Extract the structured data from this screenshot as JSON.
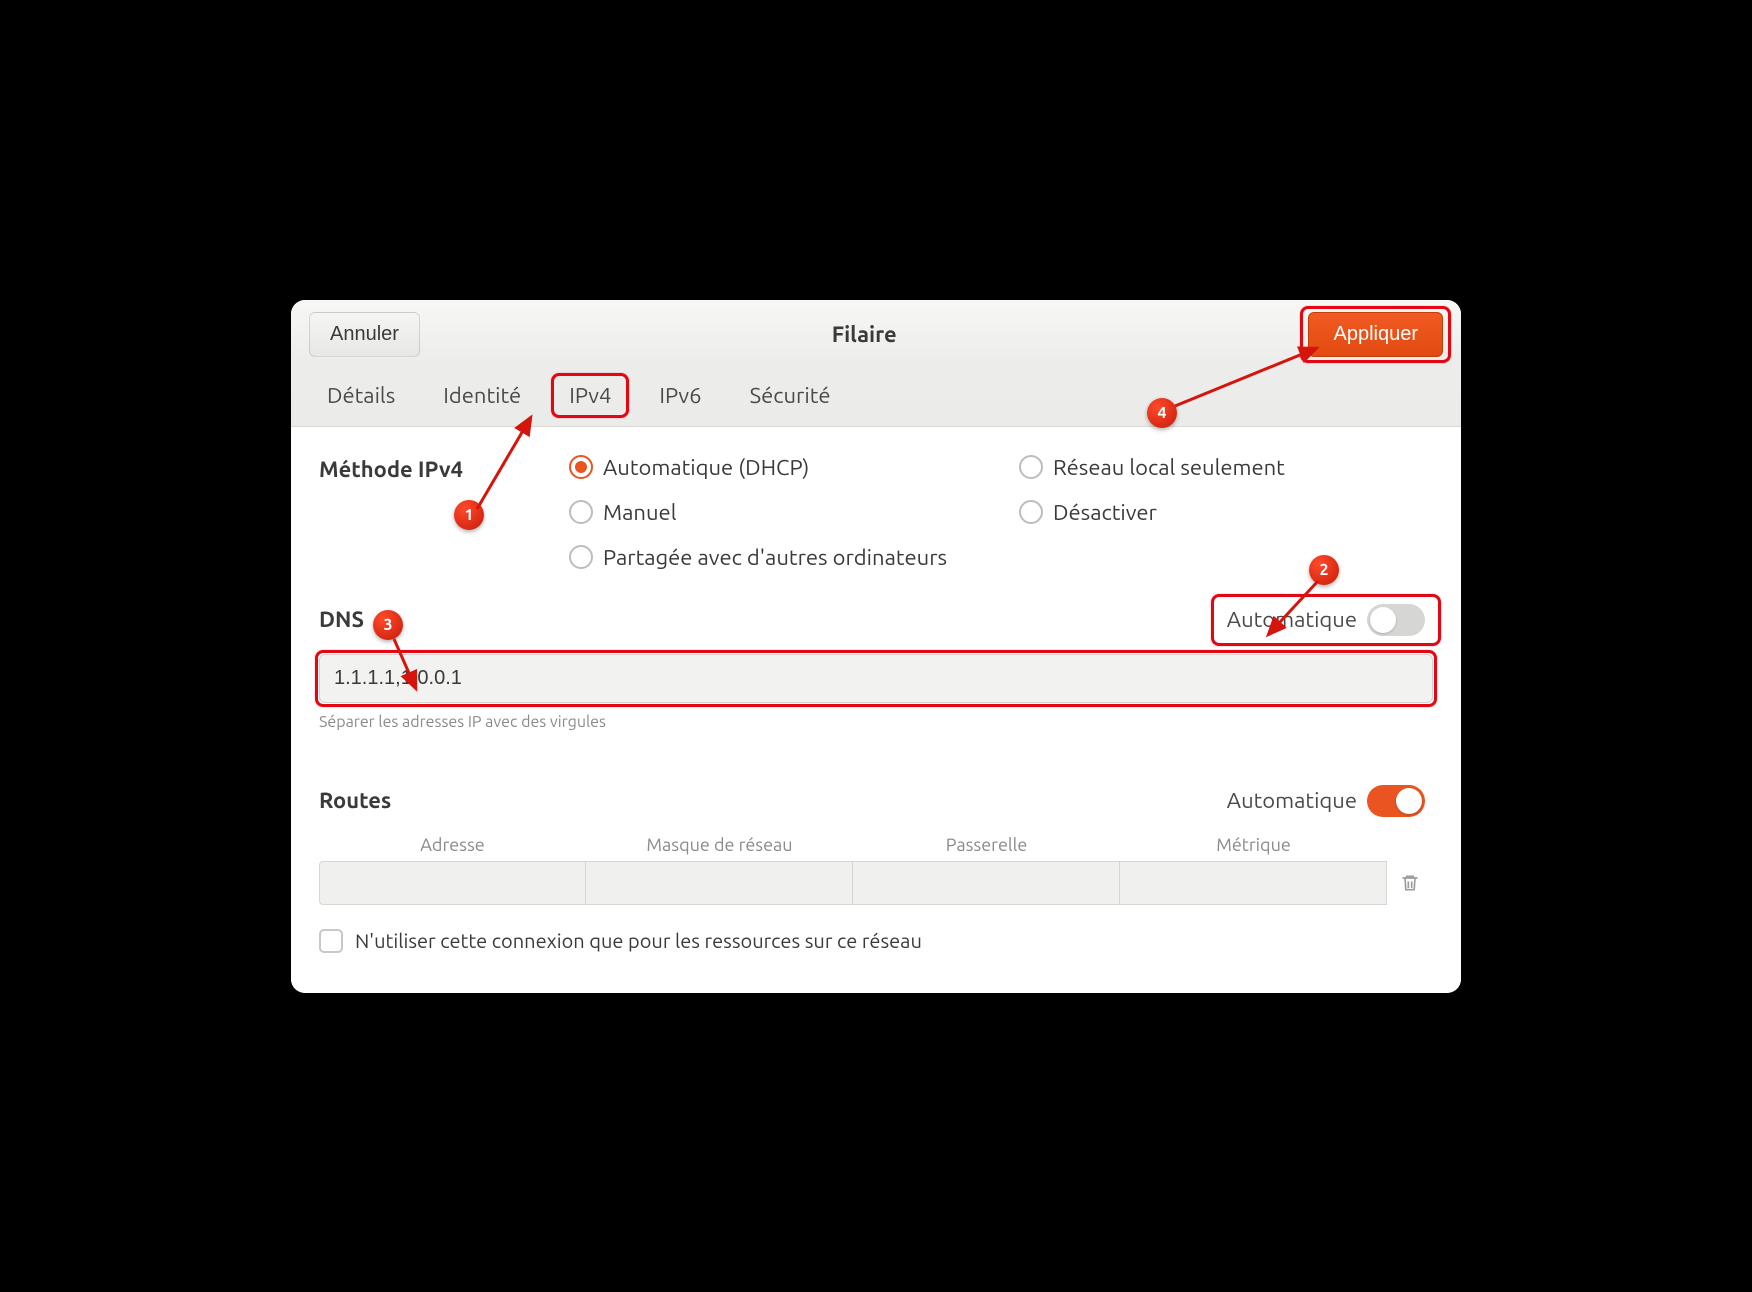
{
  "titlebar": {
    "cancel_label": "Annuler",
    "title": "Filaire",
    "apply_label": "Appliquer"
  },
  "tabs": {
    "details": "Détails",
    "identity": "Identité",
    "ipv4": "IPv4",
    "ipv6": "IPv6",
    "security": "Sécurité"
  },
  "ipv4": {
    "method_label": "Méthode IPv4",
    "options": {
      "dhcp": "Automatique (DHCP)",
      "local": "Réseau local seulement",
      "manual": "Manuel",
      "disable": "Désactiver",
      "shared": "Partagée avec d'autres ordinateurs"
    }
  },
  "dns": {
    "label": "DNS",
    "auto_label": "Automatique",
    "value": "1.1.1.1,1.0.0.1",
    "hint": "Séparer les adresses IP avec des virgules",
    "auto_on": false
  },
  "routes": {
    "label": "Routes",
    "auto_label": "Automatique",
    "auto_on": true,
    "columns": {
      "address": "Adresse",
      "netmask": "Masque de réseau",
      "gateway": "Passerelle",
      "metric": "Métrique"
    },
    "restrict_label": "N'utiliser cette connexion que pour les ressources sur ce réseau"
  },
  "annotations": {
    "1": "1",
    "2": "2",
    "3": "3",
    "4": "4"
  }
}
